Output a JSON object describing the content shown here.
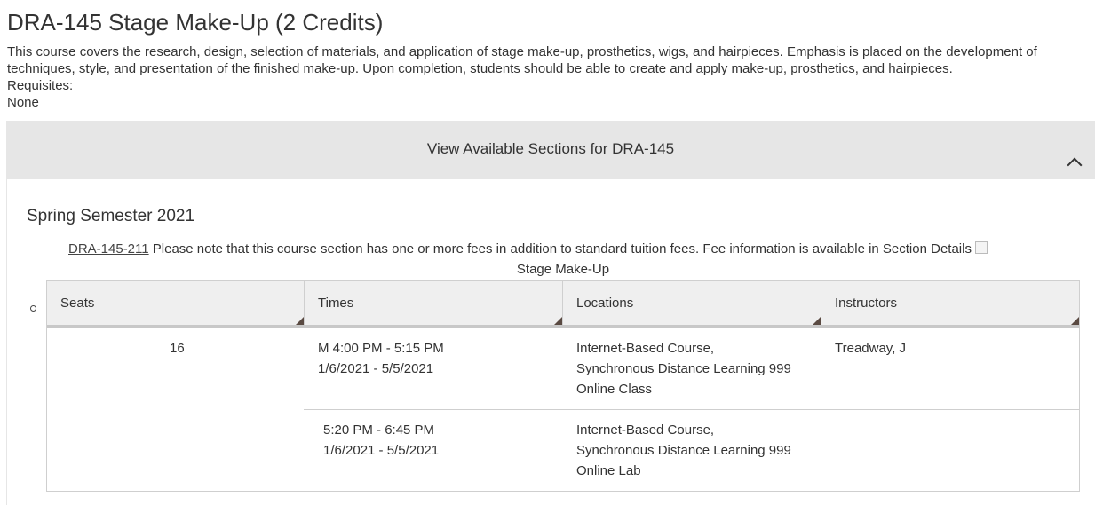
{
  "course": {
    "title": "DRA-145 Stage Make-Up (2 Credits)",
    "description": "This course covers the research, design, selection of materials, and application of stage make-up, prosthetics, wigs, and hairpieces. Emphasis is placed on the development of techniques, style, and presentation of the finished make-up. Upon completion, students should be able to create and apply make-up, prosthetics, and hairpieces.",
    "requisites_label": "Requisites:",
    "requisites_value": "None"
  },
  "sections_panel": {
    "header_label": "View Available Sections for DRA-145",
    "toggle_icon": "chevron-up-icon",
    "term": "Spring Semester 2021",
    "section": {
      "code": "DRA-145-211",
      "note": " Please note that this course section has one or more fees in addition to standard tuition fees. Fee information is available in Section Details",
      "title": "Stage Make-Up",
      "columns": [
        "Seats",
        "Times",
        "Locations",
        "Instructors"
      ],
      "seats": "16",
      "instructor": "Treadway, J",
      "meetings": [
        {
          "time": "M 4:00 PM - 5:15 PM",
          "dates": "1/6/2021 - 5/5/2021",
          "location_line1": "Internet-Based Course,",
          "location_line2": "Synchronous Distance Learning 999",
          "location_line3": "Online Class"
        },
        {
          "time": "5:20 PM - 6:45 PM",
          "dates": "1/6/2021 - 5/5/2021",
          "location_line1": "Internet-Based Course,",
          "location_line2": "Synchronous Distance Learning 999",
          "location_line3": "Online Lab"
        }
      ]
    }
  }
}
